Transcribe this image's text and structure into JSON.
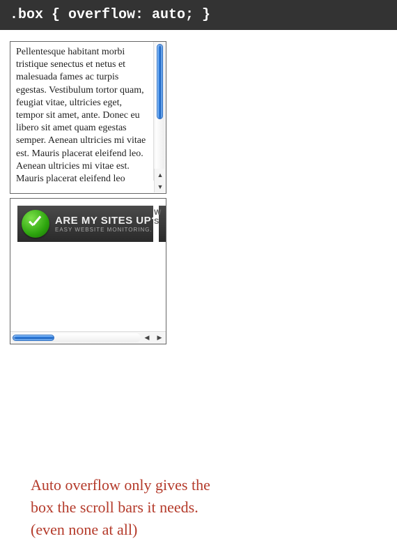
{
  "header": {
    "code": ".box { overflow: auto; }"
  },
  "box1": {
    "text": "Pellentesque habitant morbi tristique senectus et netus et malesuada fames ac turpis egestas. Vestibulum tortor quam, feugiat vitae, ultricies eget, tempor sit amet, ante. Donec eu libero sit amet quam egestas semper. Aenean ultricies mi vitae est. Mauris placerat eleifend leo. Aenean ultricies mi vitae est. Mauris placerat eleifend leo"
  },
  "box2": {
    "banner_title": "ARE MY SITES UP?",
    "banner_subtitle": "EASY WEBSITE MONITORING.",
    "edge_text": "W\nS"
  },
  "annotation": {
    "line1": "Auto overflow only gives the",
    "line2": "box the scroll bars it needs.",
    "line3": "(even none at all)"
  },
  "colors": {
    "header_bg": "#333333",
    "annotation_color": "#b43a2a",
    "scrollbar_blue": "#2d7de0",
    "banner_green": "#2da50e"
  }
}
